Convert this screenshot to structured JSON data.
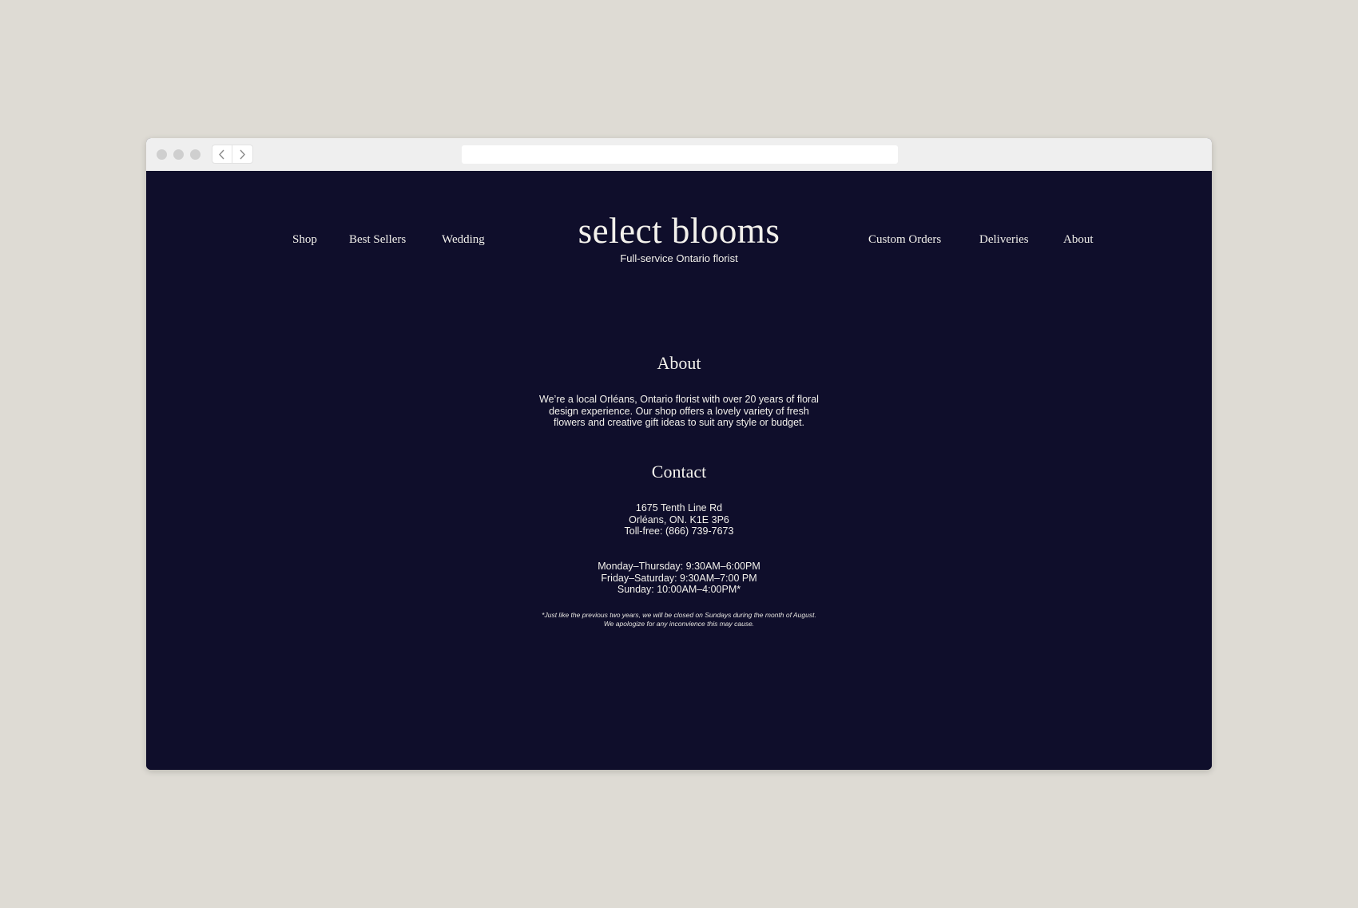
{
  "browser": {
    "back_icon": "chevron-left-icon",
    "forward_icon": "chevron-right-icon"
  },
  "colors": {
    "page_background": "#dedbd4",
    "site_background": "#0f0e2b",
    "text": "#f3f1ec"
  },
  "nav": {
    "left": [
      "Shop",
      "Best Sellers",
      "Wedding"
    ],
    "right": [
      "Custom Orders",
      "Deliveries",
      "About"
    ]
  },
  "brand": {
    "name": "select blooms",
    "tagline": "Full-service Ontario florist"
  },
  "about": {
    "heading": "About",
    "lines": [
      "We’re a local Orléans, Ontario florist with over 20 years of floral",
      "design experience. Our shop offers a lovely variety of fresh",
      "flowers and creative gift ideas to suit any style or budget."
    ]
  },
  "contact": {
    "heading": "Contact",
    "address": [
      "1675 Tenth Line Rd",
      "Orléans, ON. K1E 3P6",
      "Toll-free: (866) 739-7673"
    ],
    "hours": [
      "Monday–Thursday: 9:30AM–6:00PM",
      "Friday–Saturday: 9:30AM–7:00 PM",
      "Sunday: 10:00AM–4:00PM*"
    ],
    "note": [
      "*Just like the previous two years, we will be closed on Sundays during the month of August.",
      "We apologize for any inconvience this may cause."
    ]
  }
}
